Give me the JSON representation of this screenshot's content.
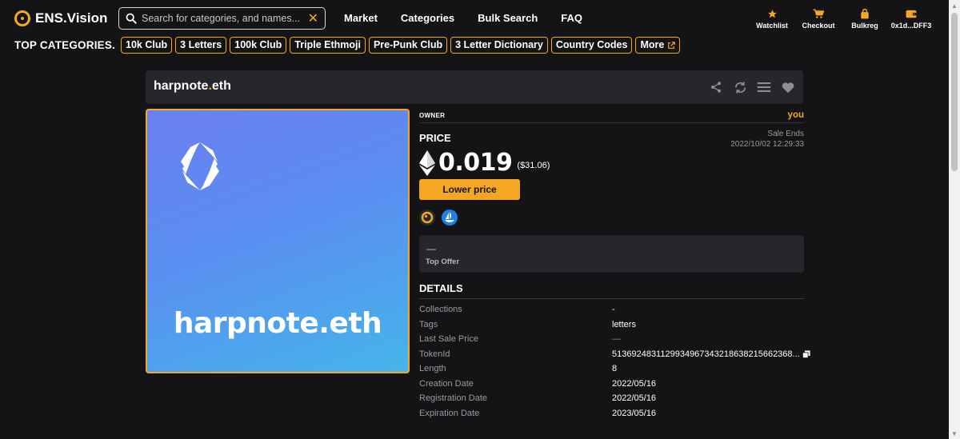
{
  "brand": {
    "name": "ENS.Vision",
    "accent": "#f5a623"
  },
  "search": {
    "placeholder": "Search for categories, and names...",
    "value": "",
    "clear_icon": "close-icon"
  },
  "nav": [
    {
      "label": "Market"
    },
    {
      "label": "Categories"
    },
    {
      "label": "Bulk Search"
    },
    {
      "label": "FAQ"
    }
  ],
  "actions": [
    {
      "label": "Watchlist",
      "icon": "star-icon"
    },
    {
      "label": "Checkout",
      "icon": "cart-icon"
    },
    {
      "label": "Bulkreg",
      "icon": "bag-icon"
    },
    {
      "label": "0x1d...DFF3",
      "icon": "wallet-icon"
    }
  ],
  "categories": {
    "title": "TOP CATEGORIES.",
    "items": [
      "10k Club",
      "3 Letters",
      "100k Club",
      "Triple Ethmoji",
      "Pre-Punk Club",
      "3 Letter Dictionary",
      "Country Codes"
    ],
    "more_label": "More"
  },
  "header": {
    "name_main": "harpnote",
    "name_dot": ".",
    "name_tld": "eth"
  },
  "nft": {
    "display_name": "harpnote.eth"
  },
  "owner": {
    "label": "OWNER",
    "value": "you"
  },
  "price": {
    "label": "PRICE",
    "sale_ends_label": "Sale Ends",
    "sale_ends_value": "2022/10/02 12:29:33",
    "amount": "0.019",
    "usd": "($31.06)",
    "lower_button": "Lower price"
  },
  "top_offer": {
    "value": "—",
    "label": "Top Offer"
  },
  "details": {
    "title": "DETAILS",
    "rows": [
      {
        "key": "Collections",
        "value": "-"
      },
      {
        "key": "Tags",
        "value": "letters"
      },
      {
        "key": "Last Sale Price",
        "value": "—"
      },
      {
        "key": "TokenId",
        "value": "5136924831129934967343218638215662368..."
      },
      {
        "key": "Length",
        "value": "8"
      },
      {
        "key": "Creation Date",
        "value": "2022/05/16"
      },
      {
        "key": "Registration Date",
        "value": "2022/05/16"
      },
      {
        "key": "Expiration Date",
        "value": "2023/05/16"
      }
    ]
  }
}
